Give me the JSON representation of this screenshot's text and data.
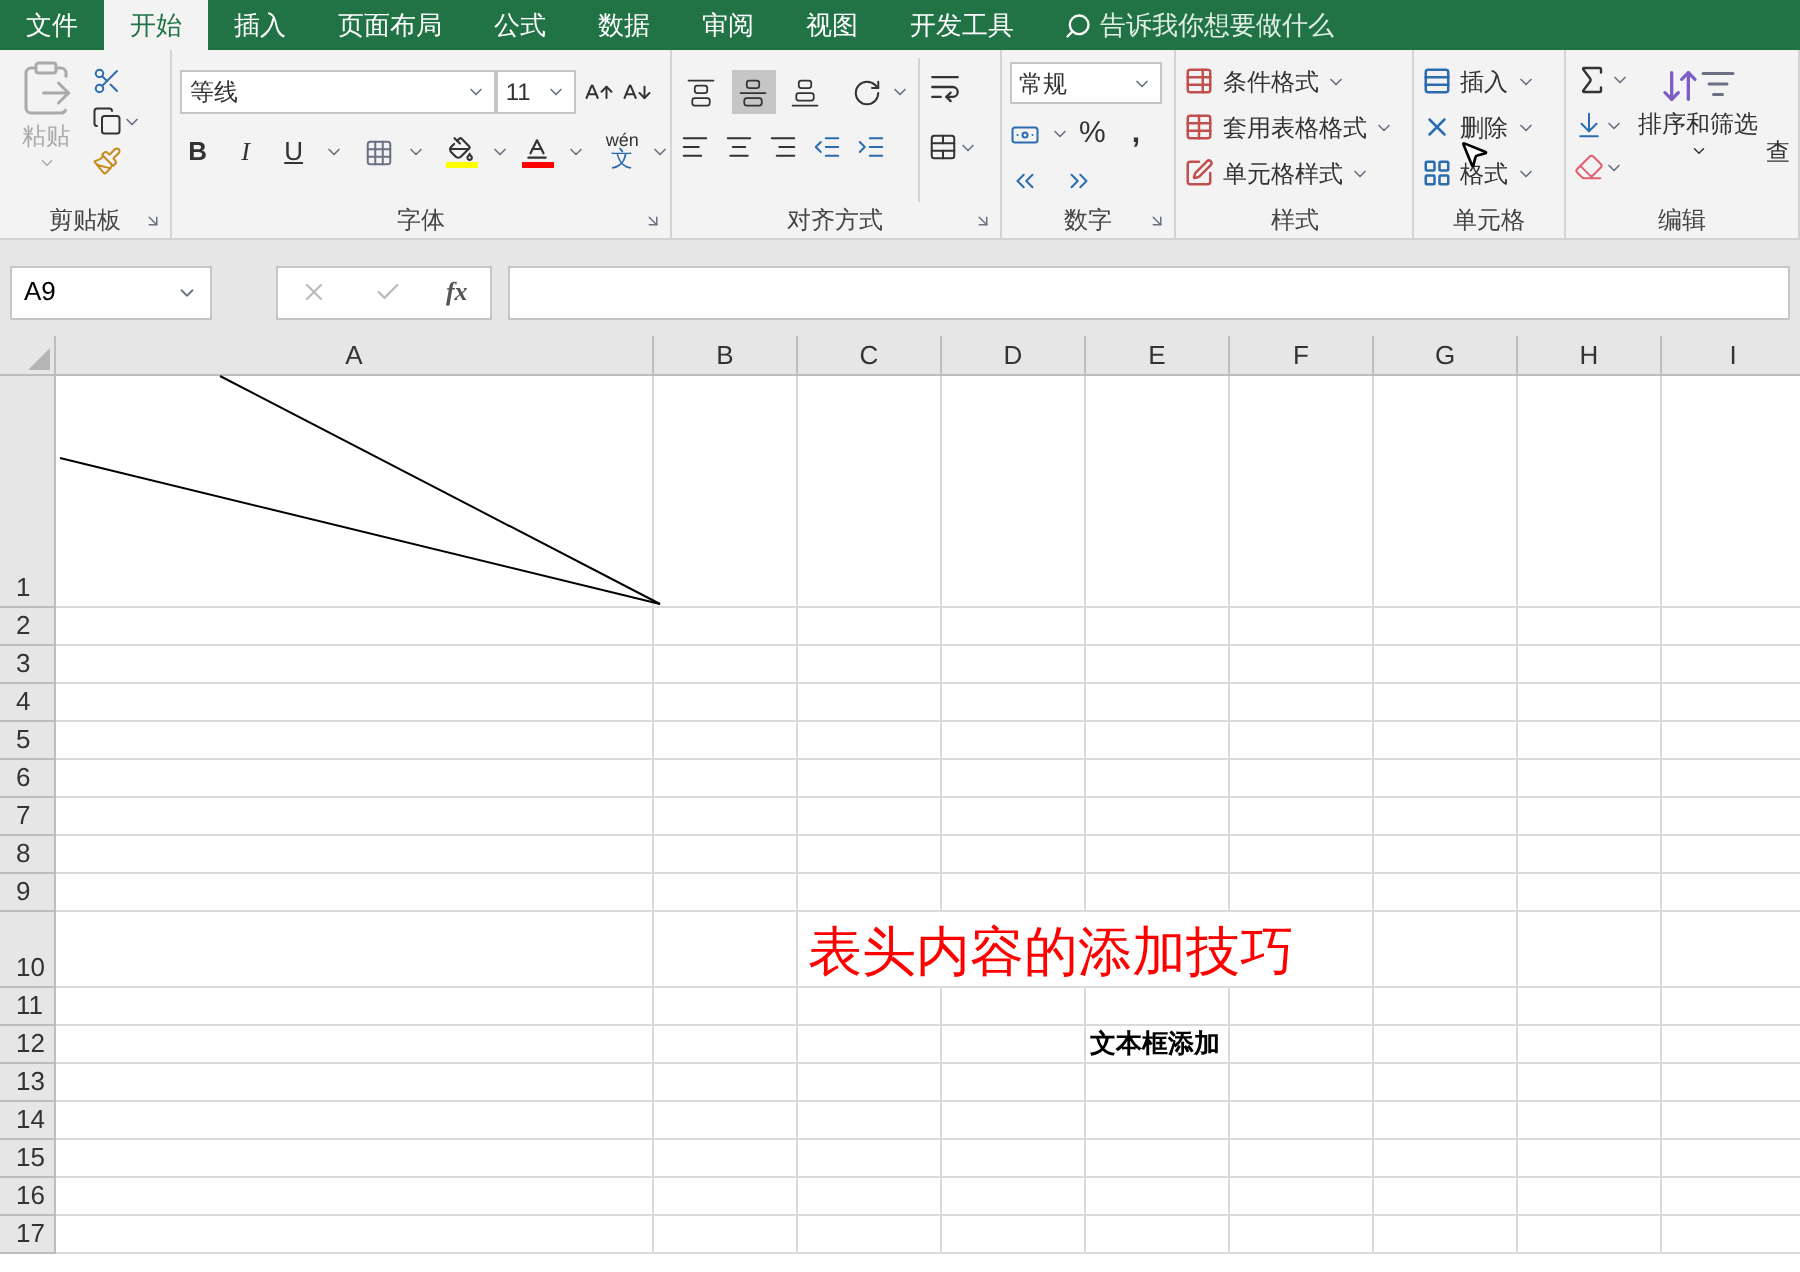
{
  "tabs": [
    {
      "label": "文件",
      "selected": false
    },
    {
      "label": "开始",
      "selected": true
    },
    {
      "label": "插入",
      "selected": false
    },
    {
      "label": "页面布局",
      "selected": false
    },
    {
      "label": "公式",
      "selected": false
    },
    {
      "label": "数据",
      "selected": false
    },
    {
      "label": "审阅",
      "selected": false
    },
    {
      "label": "视图",
      "selected": false
    },
    {
      "label": "开发工具",
      "selected": false
    }
  ],
  "tell_me": {
    "placeholder": "告诉我你想要做什么"
  },
  "ribbon": {
    "clipboard": {
      "label": "剪贴板",
      "paste": {
        "label": "粘贴",
        "disabled": true
      }
    },
    "font": {
      "label": "字体",
      "font_name": "等线",
      "font_size": "11",
      "bold": "B",
      "italic": "I",
      "underline": "U",
      "phonetic": {
        "top": "wén",
        "bottom": "文"
      }
    },
    "alignment": {
      "label": "对齐方式",
      "vertical": [
        {
          "kind": "top",
          "selected": false
        },
        {
          "kind": "middle",
          "selected": true
        },
        {
          "kind": "bottom",
          "selected": false
        }
      ]
    },
    "number": {
      "label": "数字",
      "format": "常规",
      "percent": "%",
      "comma": ","
    },
    "styles": {
      "label": "样式",
      "items": [
        "条件格式",
        "套用表格格式",
        "单元格样式"
      ]
    },
    "cells": {
      "label": "单元格",
      "items": [
        "插入",
        "删除",
        "格式"
      ]
    },
    "editing": {
      "label": "编辑",
      "sort": "排序和筛选",
      "find": "查"
    }
  },
  "formula_bar": {
    "name_box": "A9",
    "fx": "fx"
  },
  "sheet": {
    "columns": [
      "A",
      "B",
      "C",
      "D",
      "E",
      "F",
      "G",
      "H",
      "I"
    ],
    "rows": [
      {
        "label": "1"
      },
      {
        "label": "2"
      },
      {
        "label": "3"
      },
      {
        "label": "4"
      },
      {
        "label": "5"
      },
      {
        "label": "6"
      },
      {
        "label": "7"
      },
      {
        "label": "8"
      },
      {
        "label": "9"
      },
      {
        "label": "10"
      },
      {
        "label": "11"
      },
      {
        "label": "12",
        "cell_text": "文本框添加"
      },
      {
        "label": "13"
      },
      {
        "label": "14"
      },
      {
        "label": "15"
      },
      {
        "label": "16"
      },
      {
        "label": "17"
      }
    ],
    "text_box": {
      "text": "表头内容的添加技巧"
    }
  }
}
